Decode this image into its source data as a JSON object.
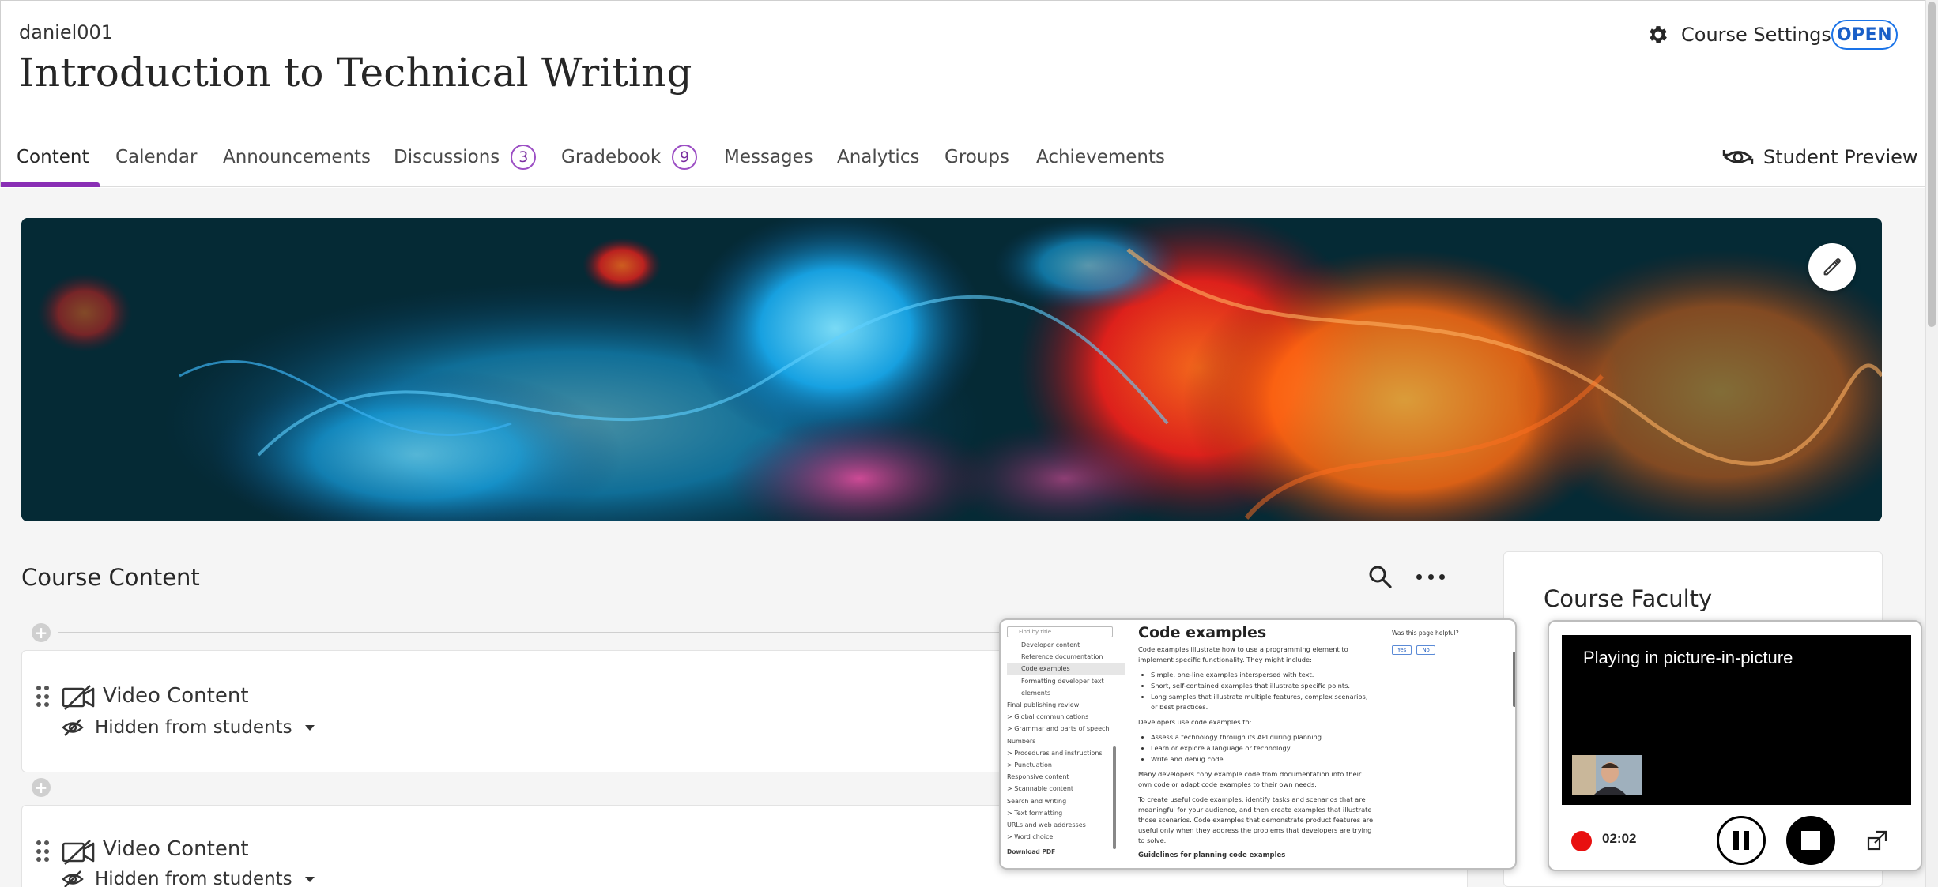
{
  "header": {
    "username": "daniel001",
    "course_title": "Introduction to Technical Writing",
    "settings_label": "Course Settings",
    "status_badge": "OPEN"
  },
  "tabs": [
    {
      "label": "Content",
      "active": true
    },
    {
      "label": "Calendar"
    },
    {
      "label": "Announcements"
    },
    {
      "label": "Discussions",
      "count": "3"
    },
    {
      "label": "Gradebook",
      "count": "9"
    },
    {
      "label": "Messages"
    },
    {
      "label": "Analytics"
    },
    {
      "label": "Groups"
    },
    {
      "label": "Achievements"
    }
  ],
  "student_preview_label": "Student Preview",
  "course_content": {
    "title": "Course Content",
    "items": [
      {
        "title": "Video Content",
        "visibility": "Hidden from students"
      },
      {
        "title": "Video Content",
        "visibility": "Hidden from students"
      }
    ]
  },
  "faculty": {
    "title": "Course Faculty"
  },
  "doc_preview": {
    "find_placeholder": "Find by title",
    "nav": [
      {
        "label": "Developer content",
        "indent": true
      },
      {
        "label": "Reference documentation",
        "indent": true
      },
      {
        "label": "Code examples",
        "indent": true,
        "selected": true
      },
      {
        "label": "Formatting developer text",
        "indent": true
      },
      {
        "label": "elements",
        "indent": true
      },
      {
        "label": "Final publishing review"
      },
      {
        "label": "> Global communications"
      },
      {
        "label": "> Grammar and parts of speech"
      },
      {
        "label": "Numbers"
      },
      {
        "label": "> Procedures and instructions"
      },
      {
        "label": "> Punctuation"
      },
      {
        "label": "Responsive content"
      },
      {
        "label": "> Scannable content"
      },
      {
        "label": "Search and writing"
      },
      {
        "label": "> Text formatting"
      },
      {
        "label": "URLs and web addresses"
      },
      {
        "label": "> Word choice"
      }
    ],
    "download_pdf": "Download PDF",
    "heading": "Code examples",
    "intro": "Code examples illustrate how to use a programming element to implement specific functionality. They might include:",
    "bullets1": [
      "Simple, one-line examples interspersed with text.",
      "Short, self-contained examples that illustrate specific points.",
      "Long samples that illustrate multiple features, complex scenarios, or best practices."
    ],
    "para2": "Developers use code examples to:",
    "bullets2": [
      "Assess a technology through its API during planning.",
      "Learn or explore a language or technology.",
      "Write and debug code."
    ],
    "para3": "Many developers copy example code from documentation into their own code or adapt code examples to their own needs.",
    "para4": "To create useful code examples, identify tasks and scenarios that are meaningful for your audience, and then create examples that illustrate those scenarios. Code examples that demonstrate product features are useful only when they address the problems that developers are trying to solve.",
    "subheading": "Guidelines for planning code examples",
    "helpful_label": "Was this page helpful?",
    "yes_label": "Yes",
    "no_label": "No"
  },
  "pip": {
    "status_text": "Playing in picture-in-picture",
    "timer": "02:02"
  },
  "colors": {
    "accent": "#8a2fb5",
    "badge_blue": "#1a73e8",
    "record_red": "#e81010"
  }
}
